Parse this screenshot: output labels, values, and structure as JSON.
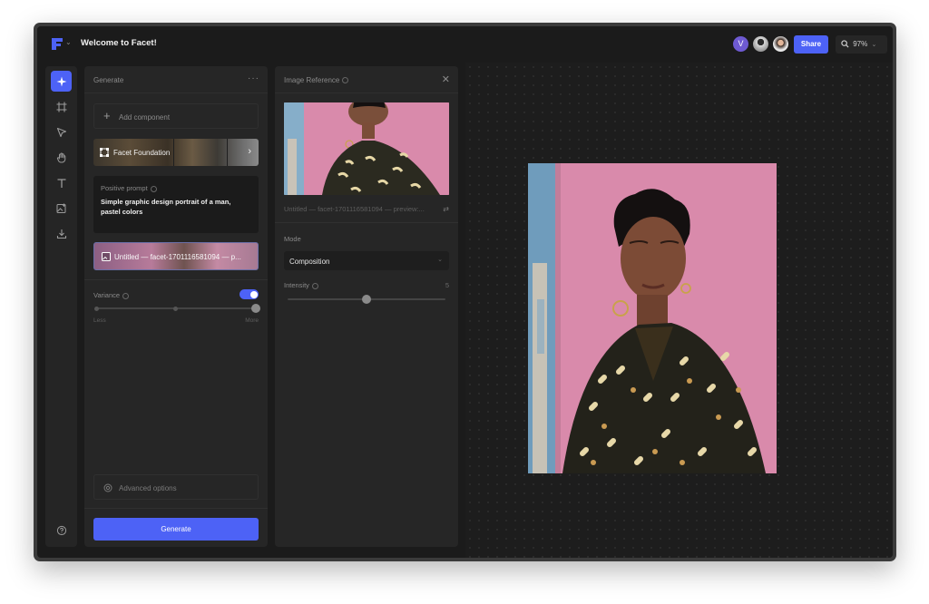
{
  "app": {
    "title": "Welcome to Facet!",
    "brand_color": "#4d62f6"
  },
  "topbar": {
    "avatar_initial": "V",
    "share_label": "Share",
    "zoom_label": "97%"
  },
  "tools": [
    "sparkle-icon",
    "frame-icon",
    "pointer-icon",
    "hand-icon",
    "text-icon",
    "image-add-icon",
    "download-icon",
    "help-icon"
  ],
  "generate_panel": {
    "title": "Generate",
    "more_label": "···",
    "add_component_label": "Add component",
    "foundation_label": "Facet Foundation",
    "prompt_label": "Positive prompt",
    "prompt_text": "Simple graphic design portrait of a man, pastel colors",
    "image_ref_label": "Untitled — facet-1701116581094 — p...",
    "variance_label": "Variance",
    "variance_enabled": true,
    "variance_value": 1.0,
    "variance_min_label": "Less",
    "variance_max_label": "More",
    "advanced_label": "Advanced options",
    "generate_label": "Generate"
  },
  "reference_panel": {
    "title": "Image Reference",
    "close_label": "✕",
    "image_meta": "Untitled — facet-1701116581094 — preview:...",
    "mode_label": "Mode",
    "mode_value": "Composition",
    "intensity_label": "Intensity",
    "intensity_value": "5",
    "intensity_fraction": 0.5
  }
}
